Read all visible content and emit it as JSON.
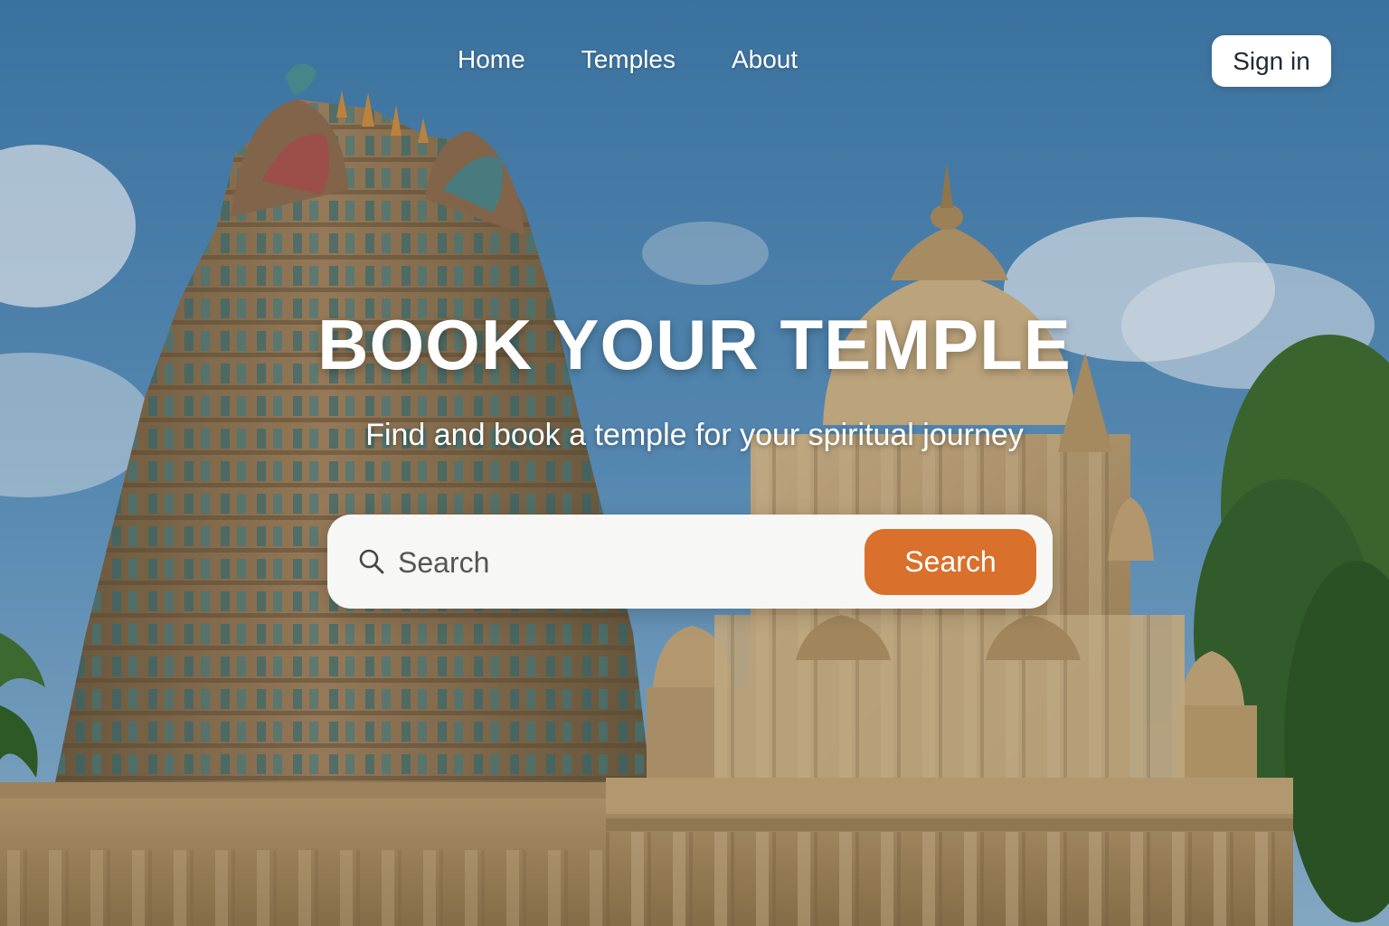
{
  "nav": {
    "items": [
      {
        "label": "Home"
      },
      {
        "label": "Temples"
      },
      {
        "label": "About"
      }
    ],
    "signin_label": "Sign in"
  },
  "hero": {
    "title": "BOOK YOUR TEMPLE",
    "subtitle": "Find and book a temple for your spiritual journey"
  },
  "search": {
    "placeholder": "Search",
    "value": "",
    "button_label": "Search"
  },
  "colors": {
    "accent": "#d9702b",
    "sky": "#4f89b6",
    "stone": "#b99a66",
    "gopuram_blue": "#3f7f84"
  },
  "icons": {
    "search": "search-icon"
  }
}
